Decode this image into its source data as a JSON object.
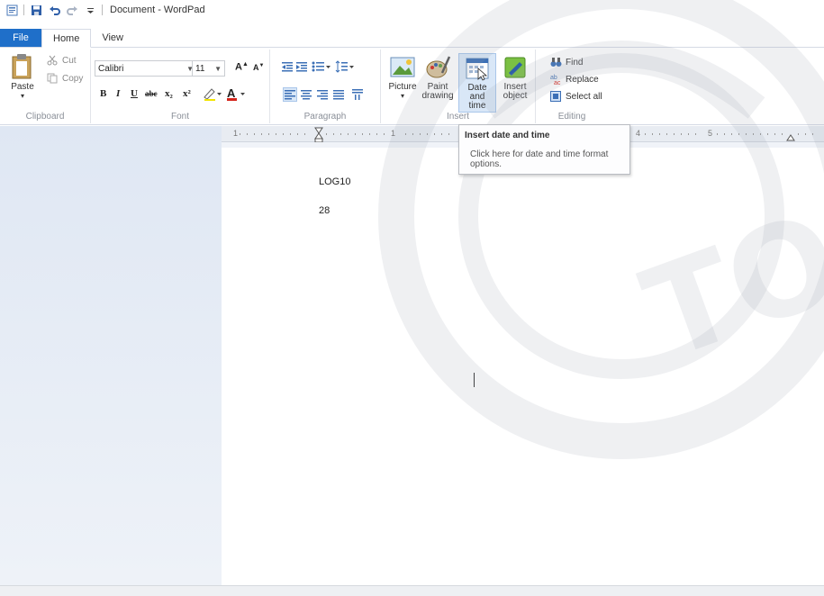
{
  "window": {
    "title": "Document - WordPad"
  },
  "tabs": {
    "file": "File",
    "home": "Home",
    "view": "View"
  },
  "clipboard": {
    "paste": "Paste",
    "cut": "Cut",
    "copy": "Copy",
    "label": "Clipboard"
  },
  "font": {
    "family": "Calibri",
    "size": "11",
    "label": "Font",
    "bold": "B",
    "italic": "I",
    "underline": "U",
    "strike": "abc",
    "sub": "x₂",
    "sup": "x²"
  },
  "paragraph": {
    "label": "Paragraph"
  },
  "insert": {
    "picture": "Picture",
    "paint_line1": "Paint",
    "paint_line2": "drawing",
    "date_line1": "Date and",
    "date_line2": "time",
    "object_line1": "Insert",
    "object_line2": "object",
    "label": "Insert"
  },
  "editing": {
    "find": "Find",
    "replace": "Replace",
    "select_all": "Select all",
    "label": "Editing"
  },
  "ruler": {
    "marks": [
      "1",
      "1",
      "4",
      "5"
    ]
  },
  "document": {
    "lines": [
      "LOG10",
      "28"
    ]
  },
  "tooltip": {
    "title": "Insert date and time",
    "body": "Click here for date and time format options."
  },
  "colors": {
    "file_tab": "#1f6fc9",
    "left_pane": "#dfe7f3"
  }
}
